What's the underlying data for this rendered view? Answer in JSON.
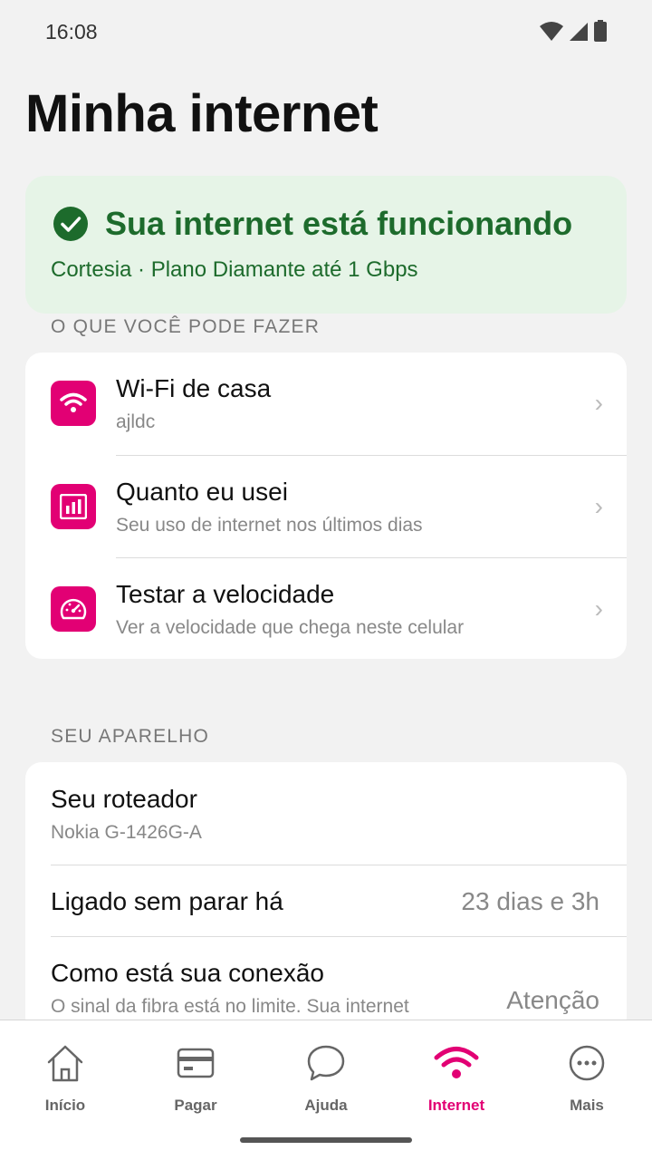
{
  "status_bar": {
    "time": "16:08"
  },
  "page_title": "Minha internet",
  "status_card": {
    "headline": "Sua internet está funcionando",
    "subtitle": "Cortesia · Plano Diamante até 1 Gbps"
  },
  "actions_section": {
    "label": "O QUE VOCÊ PODE FAZER",
    "items": [
      {
        "title": "Wi-Fi de casa",
        "subtitle": "ajldc",
        "icon": "wifi-icon"
      },
      {
        "title": "Quanto eu usei",
        "subtitle": "Seu uso de internet nos últimos dias",
        "icon": "bar-chart-icon"
      },
      {
        "title": "Testar a velocidade",
        "subtitle": "Ver a velocidade que chega neste celular",
        "icon": "speedometer-icon"
      }
    ]
  },
  "device_section": {
    "label": "SEU APARELHO",
    "router_title": "Seu roteador",
    "router_model": "Nokia G-1426G-A",
    "uptime_label": "Ligado sem parar há",
    "uptime_value": "23 dias e 3h",
    "connection_label": "Como está sua conexão",
    "connection_detail": "O sinal da fibra está no limite. Sua internet",
    "connection_value": "Atenção"
  },
  "bottom_nav": [
    {
      "label": "Início",
      "icon": "home-icon"
    },
    {
      "label": "Pagar",
      "icon": "card-icon"
    },
    {
      "label": "Ajuda",
      "icon": "chat-icon"
    },
    {
      "label": "Internet",
      "icon": "wifi-icon",
      "active": true
    },
    {
      "label": "Mais",
      "icon": "more-icon"
    }
  ],
  "colors": {
    "accent": "#e20074",
    "success": "#1d6b2c",
    "success_bg": "#e6f4e7"
  }
}
